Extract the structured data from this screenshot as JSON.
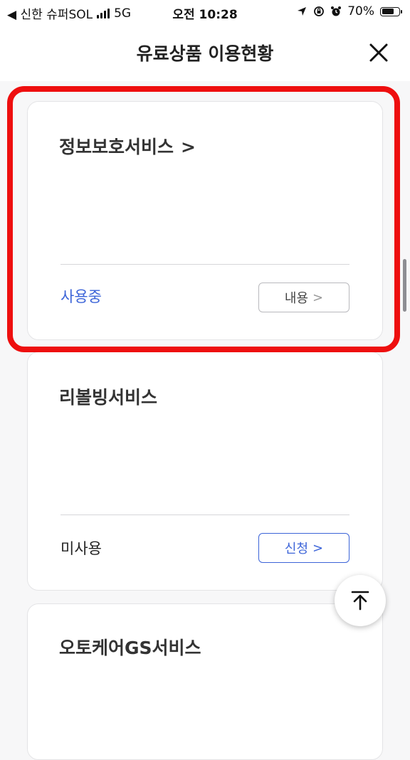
{
  "status_bar": {
    "back_app": "◀ 신한 슈퍼SOL",
    "network": "5G",
    "time": "오전 10:28",
    "battery": "70%",
    "battery_level": 0.7
  },
  "header": {
    "title": "유료상품 이용현황",
    "close_icon": "close-icon"
  },
  "cards": [
    {
      "title": "정보보호서비스",
      "title_chevron": ">",
      "status": "사용중",
      "status_color": "#3c64d8",
      "button_label": "내용",
      "button_chevron": ">",
      "button_style": "gray"
    },
    {
      "title": "리볼빙서비스",
      "status": "미사용",
      "status_color": "#222222",
      "button_label": "신청",
      "button_chevron": ">",
      "button_style": "blue"
    },
    {
      "title": "오토케어GS서비스"
    }
  ],
  "highlight_color": "#ee0f0f",
  "fab": {
    "icon": "arrow-up-to-top-icon"
  }
}
